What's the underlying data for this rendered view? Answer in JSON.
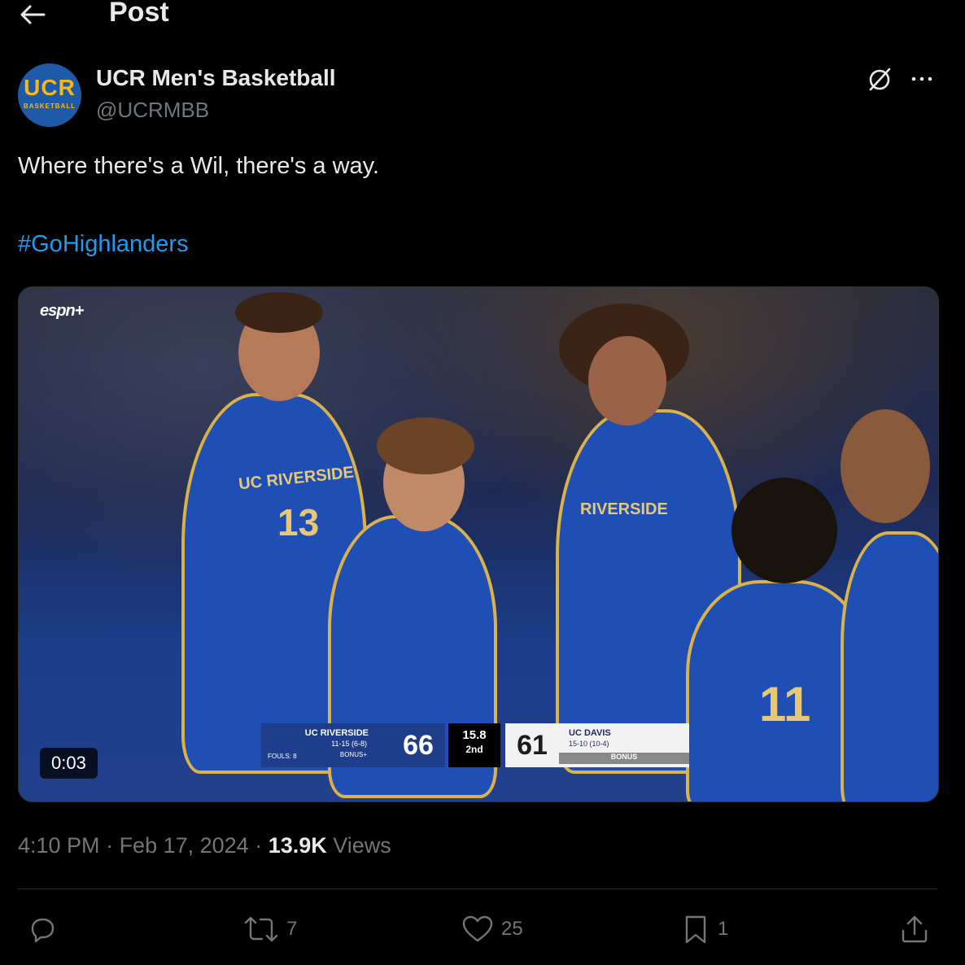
{
  "header": {
    "title": "Post"
  },
  "author": {
    "avatar_text": "UCR",
    "avatar_subtext": "BASKETBALL",
    "display_name": "UCR Men's Basketball",
    "handle": "@UCRMBB"
  },
  "tweet": {
    "text": "Where there's a Wil, there's a way.",
    "hashtag": "#GoHighlanders"
  },
  "video": {
    "duration": "0:03",
    "network": "espn+",
    "scorebug": {
      "home_team": "UC RIVERSIDE",
      "home_record": "11-15 (6-8)",
      "home_fouls": "FOULS: 8",
      "home_bonus": "BONUS+",
      "home_score": "66",
      "clock": "15.8",
      "period": "2nd",
      "away_score": "61",
      "away_team": "UC DAVIS",
      "away_record": "15-10 (10-4)",
      "away_bonus": "BONUS"
    },
    "jersey_labels": {
      "left_jersey_team": "UC RIVERSIDE",
      "left_jersey_number": "13",
      "center_jersey_team": "RIVERSIDE",
      "right_jersey_number": "11"
    }
  },
  "meta": {
    "time": "4:10 PM",
    "separator": " · ",
    "date": "Feb 17, 2024",
    "views_count": "13.9K",
    "views_label": " Views"
  },
  "actions": {
    "replies": "",
    "reposts": "7",
    "likes": "25",
    "bookmarks": "1"
  },
  "colors": {
    "background": "#000000",
    "text_primary": "#e7e9ea",
    "text_secondary": "#71767b",
    "link": "#1d9bf0",
    "divider": "#2f3336"
  }
}
